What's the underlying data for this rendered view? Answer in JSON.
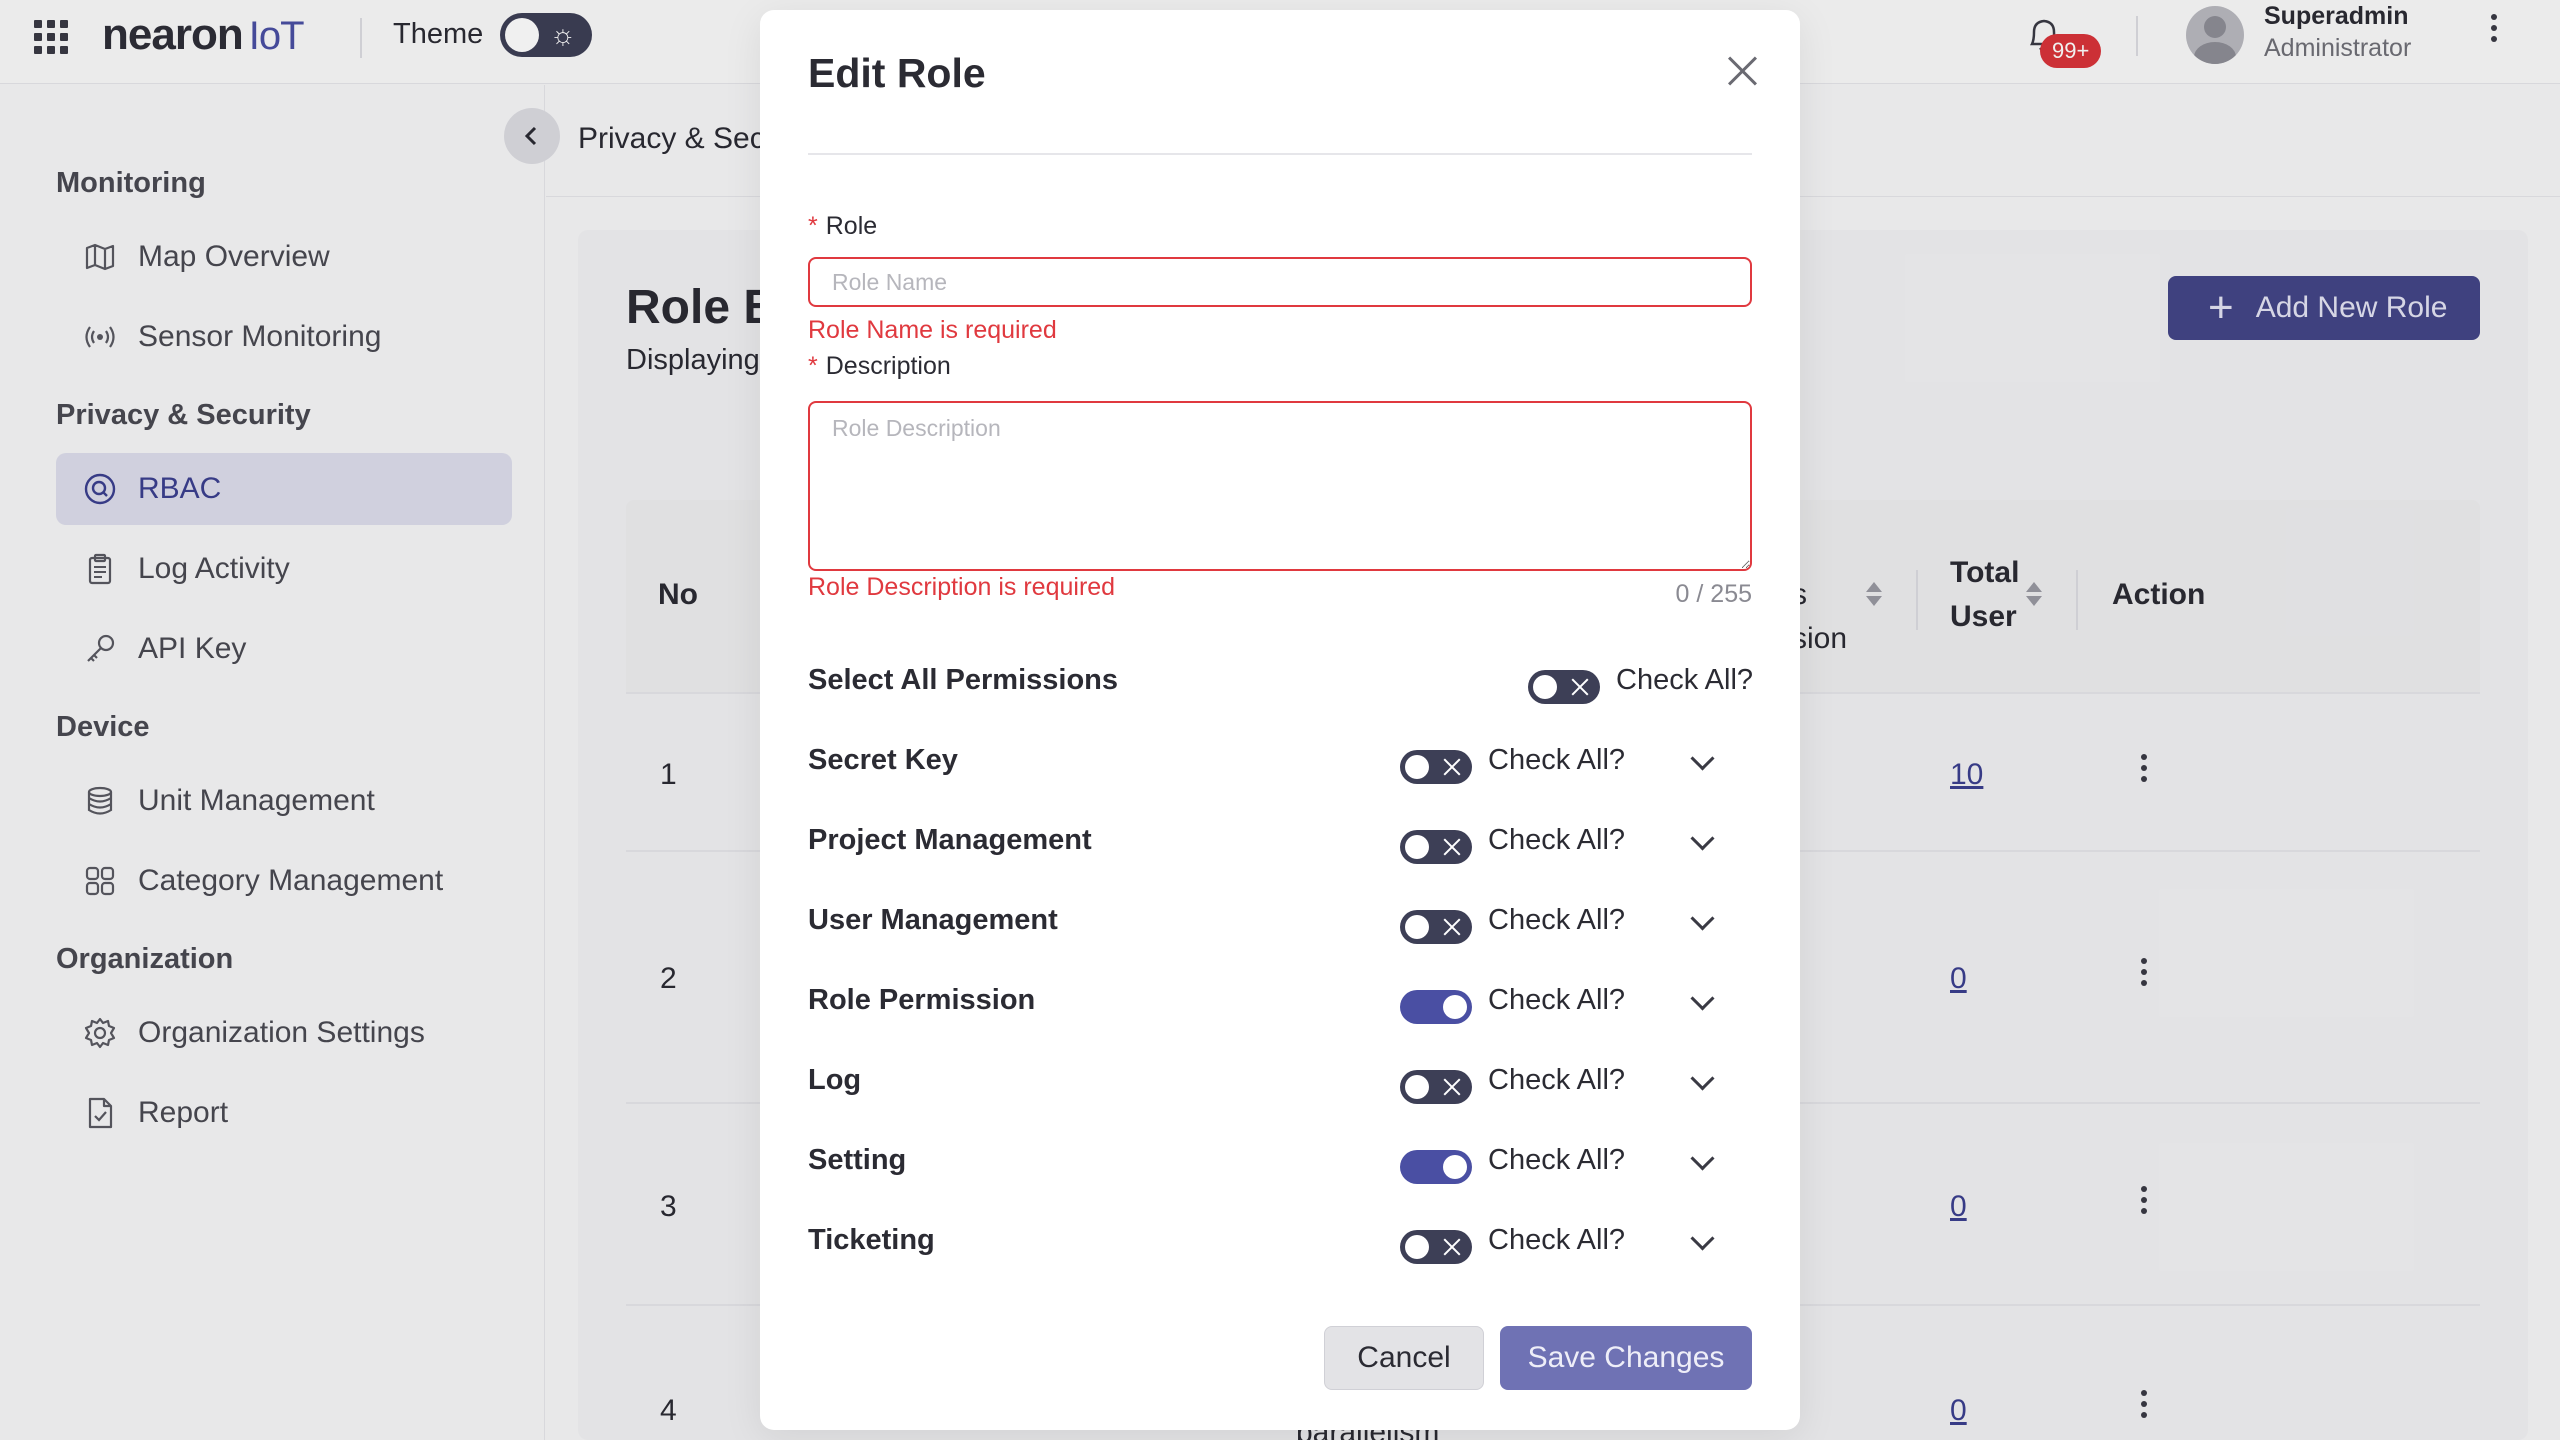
{
  "topbar": {
    "brand_main": "nearon",
    "brand_suffix": "IoT",
    "theme_label": "Theme",
    "notification_count": "99+",
    "user_name": "Superadmin",
    "user_role": "Administrator"
  },
  "sidebar": {
    "sections": [
      {
        "title": "Monitoring",
        "items": [
          {
            "label": "Map Overview",
            "icon": "map-icon"
          },
          {
            "label": "Sensor Monitoring",
            "icon": "sensor-icon"
          }
        ]
      },
      {
        "title": "Privacy & Security",
        "items": [
          {
            "label": "RBAC",
            "icon": "shield-search-icon",
            "active": true
          },
          {
            "label": "Log Activity",
            "icon": "clipboard-icon"
          },
          {
            "label": "API Key",
            "icon": "key-icon"
          }
        ]
      },
      {
        "title": "Device",
        "items": [
          {
            "label": "Unit Management",
            "icon": "database-icon"
          },
          {
            "label": "Category Management",
            "icon": "category-grid-icon"
          }
        ]
      },
      {
        "title": "Organization",
        "items": [
          {
            "label": "Organization Settings",
            "icon": "gear-icon"
          },
          {
            "label": "Report",
            "icon": "report-file-icon"
          }
        ]
      }
    ]
  },
  "background": {
    "breadcrumb": "Privacy & Sec",
    "page_title": "Role B",
    "page_subtitle": "Displaying",
    "add_button": "Add New Role",
    "table": {
      "col_no": "No",
      "col_permission_partial_top": "s",
      "col_permission_partial_bottom": "sion",
      "col_total_top": "Total",
      "col_total_bottom": "User",
      "col_action": "Action",
      "rows": [
        {
          "no": "1",
          "total": "10"
        },
        {
          "no": "2",
          "total": "0"
        },
        {
          "no": "3",
          "total": "0"
        },
        {
          "no": "4",
          "total": "0",
          "partial": "parallelism"
        }
      ]
    }
  },
  "modal": {
    "title": "Edit Role",
    "role_label": "Role",
    "role_placeholder": "Role Name",
    "role_value": "",
    "role_error": "Role Name is required",
    "desc_label": "Description",
    "desc_placeholder": "Role Description",
    "desc_value": "",
    "desc_error": "Role Description is required",
    "desc_counter": "0 / 255",
    "select_all_label": "Select All Permissions",
    "check_all_label": "Check All?",
    "select_all_on": false,
    "permissions": [
      {
        "label": "Secret Key",
        "on": false
      },
      {
        "label": "Project Management",
        "on": false
      },
      {
        "label": "User Management",
        "on": false
      },
      {
        "label": "Role Permission",
        "on": true
      },
      {
        "label": "Log",
        "on": false
      },
      {
        "label": "Setting",
        "on": true
      },
      {
        "label": "Ticketing",
        "on": false
      }
    ],
    "cancel_label": "Cancel",
    "save_label": "Save Changes"
  },
  "colors": {
    "accent": "#4a4fa3",
    "error": "#e0393f",
    "badge": "#d9343a",
    "primary_button": "#434687"
  }
}
